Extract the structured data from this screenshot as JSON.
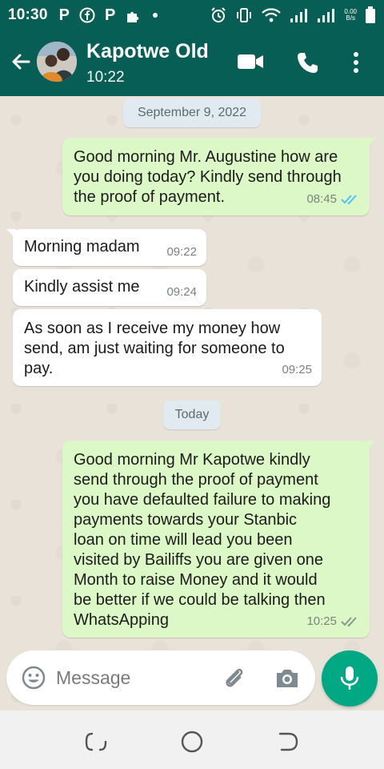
{
  "status_bar": {
    "time": "10:30",
    "left_icons": [
      "p-icon",
      "facebook-icon",
      "p-icon",
      "puzzle-icon",
      "dot-icon"
    ],
    "speed_top": "0.00",
    "speed_bottom": "B/s"
  },
  "header": {
    "contact_name": "Kapotwe Old",
    "status": "10:22",
    "icons": [
      "back-arrow-icon",
      "video-call-icon",
      "phone-icon",
      "more-vert-icon"
    ]
  },
  "colors": {
    "brand": "#075e54",
    "outgoing_bubble": "#dcf8c6",
    "incoming_bubble": "#ffffff",
    "fab": "#00a884",
    "read_ticks": "#4fc3f7"
  },
  "chat": {
    "date_1": "September 9, 2022",
    "m1_lines": [
      "Good morning Mr. Augustine how are",
      "you doing today? Kindly send through",
      "the proof of payment."
    ],
    "m1_time": "08:45",
    "m2_text": "Morning madam",
    "m2_time": "09:22",
    "m3_text": "Kindly assist me",
    "m3_time": "09:24",
    "m4_lines": [
      "As soon as I receive my money how",
      "send, am just waiting for someone to",
      "pay."
    ],
    "m4_time": "09:25",
    "date_2": "Today",
    "m5_lines": [
      "Good morning Mr Kapotwe kindly",
      "send through the proof of payment",
      "you have defaulted failure to making",
      "payments towards your Stanbic",
      "loan on time will lead you been",
      "visited by Bailiffs you are given one",
      "Month to raise Money and it would",
      "be better if we could be talking then",
      "WhatsApping"
    ],
    "m5_time": "10:25"
  },
  "composer": {
    "placeholder": "Message",
    "icons": [
      "emoji-icon",
      "attach-icon",
      "camera-icon",
      "mic-icon"
    ]
  }
}
